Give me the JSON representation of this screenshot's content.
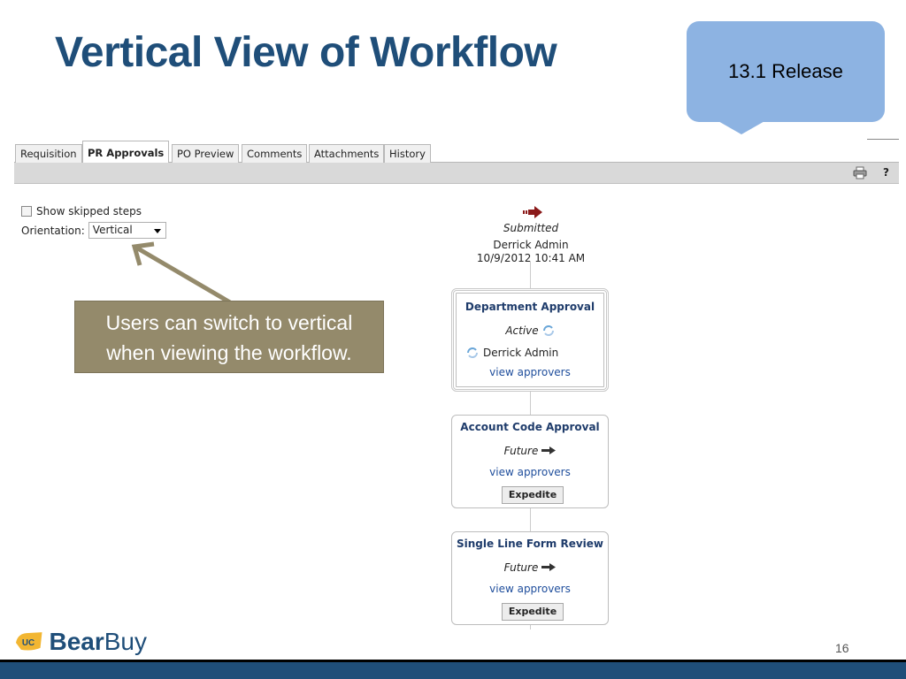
{
  "slide": {
    "title": "Vertical View of Workflow",
    "callout": "13.1 Release",
    "annotation_line1": "Users can switch to vertical",
    "annotation_line2": "when viewing the workflow.",
    "page_number": "16",
    "logo_badge": "UC",
    "logo_bear": "Bear",
    "logo_buy": "Buy"
  },
  "tabs": [
    {
      "label": "Requisition",
      "active": false
    },
    {
      "label": "PR Approvals",
      "active": true
    },
    {
      "label": "PO Preview",
      "active": false
    },
    {
      "label": "Comments",
      "active": false
    },
    {
      "label": "Attachments",
      "active": false
    },
    {
      "label": "History",
      "active": false
    }
  ],
  "toolbar": {
    "print_icon": "printer-icon",
    "help_label": "?"
  },
  "options": {
    "show_skipped_label": "Show skipped steps",
    "show_skipped_checked": false,
    "orientation_label": "Orientation:",
    "orientation_value": "Vertical"
  },
  "workflow": {
    "submitted": {
      "status": "Submitted",
      "user": "Derrick Admin",
      "datetime": "10/9/2012 10:41 AM"
    },
    "steps": [
      {
        "title": "Department Approval",
        "status": "Active",
        "approver": "Derrick Admin",
        "link": "view approvers",
        "button": ""
      },
      {
        "title": "Account Code Approval",
        "status": "Future",
        "approver": "",
        "link": "view approvers",
        "button": "Expedite"
      },
      {
        "title": "Single Line Form Review",
        "status": "Future",
        "approver": "",
        "link": "view approvers",
        "button": "Expedite"
      }
    ]
  },
  "colors": {
    "title": "#1f4e79",
    "callout": "#8db3e2",
    "annotation": "#948a6b",
    "step_title": "#1f3c6b",
    "link": "#1f4e9c",
    "submitted_arrow": "#8b1a1a"
  }
}
